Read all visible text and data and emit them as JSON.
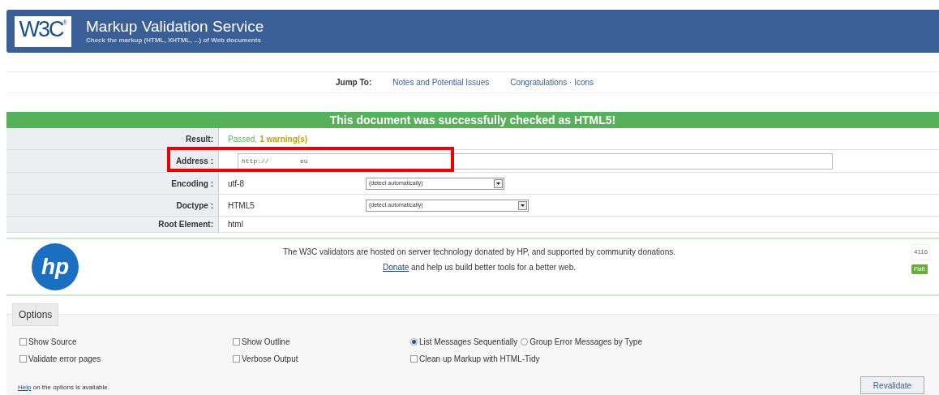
{
  "header": {
    "logo": "W3C",
    "logo_mark": "®",
    "title": "Markup Validation Service",
    "subtitle": "Check the markup (HTML, XHTML, ...) of Web documents"
  },
  "jump_to": {
    "label": "Jump To:",
    "links": [
      "Notes and Potential Issues",
      "Congratulations · Icons"
    ]
  },
  "banner": "This document was successfully checked as HTML5!",
  "results": [
    {
      "label": "Result:",
      "kind": "result",
      "passed": "Passed,",
      "warnings": "1 warning(s)"
    },
    {
      "label": "Address :",
      "kind": "field",
      "value": "http://        eu",
      "highlight": true
    },
    {
      "label": "Encoding :",
      "kind": "select",
      "value": "utf-8",
      "option": "(detect automatically)"
    },
    {
      "label": "Doctype :",
      "kind": "select",
      "value": "HTML5",
      "option": "(detect automatically)"
    },
    {
      "label": "Root Element:",
      "kind": "text",
      "value": "html"
    }
  ],
  "sponsor": {
    "logo": "hp",
    "line1": "The W3C validators are hosted on server technology donated by HP, and supported by community donations.",
    "link": "Donate",
    "line2": "and help us build better tools for a better web.",
    "count": "4116",
    "button": "Flatt"
  },
  "options": {
    "title": "Options",
    "items": [
      {
        "kind": "checkbox",
        "label": "Show Source",
        "checked": false
      },
      {
        "kind": "checkbox",
        "label": "Show Outline",
        "checked": false
      },
      {
        "kind": "radio",
        "label": "List Messages Sequentially",
        "checked": true
      },
      {
        "kind": "radio",
        "label": "Group Error Messages by Type",
        "checked": false
      },
      {
        "kind": "checkbox",
        "label": "Validate error pages",
        "checked": false
      },
      {
        "kind": "checkbox",
        "label": "Verbose Output",
        "checked": false
      },
      {
        "kind": "checkbox",
        "label": "Clean up Markup with HTML-Tidy",
        "checked": false
      }
    ],
    "help_link": "Help",
    "help_text": "on the options is available.",
    "button": "Revalidate"
  }
}
